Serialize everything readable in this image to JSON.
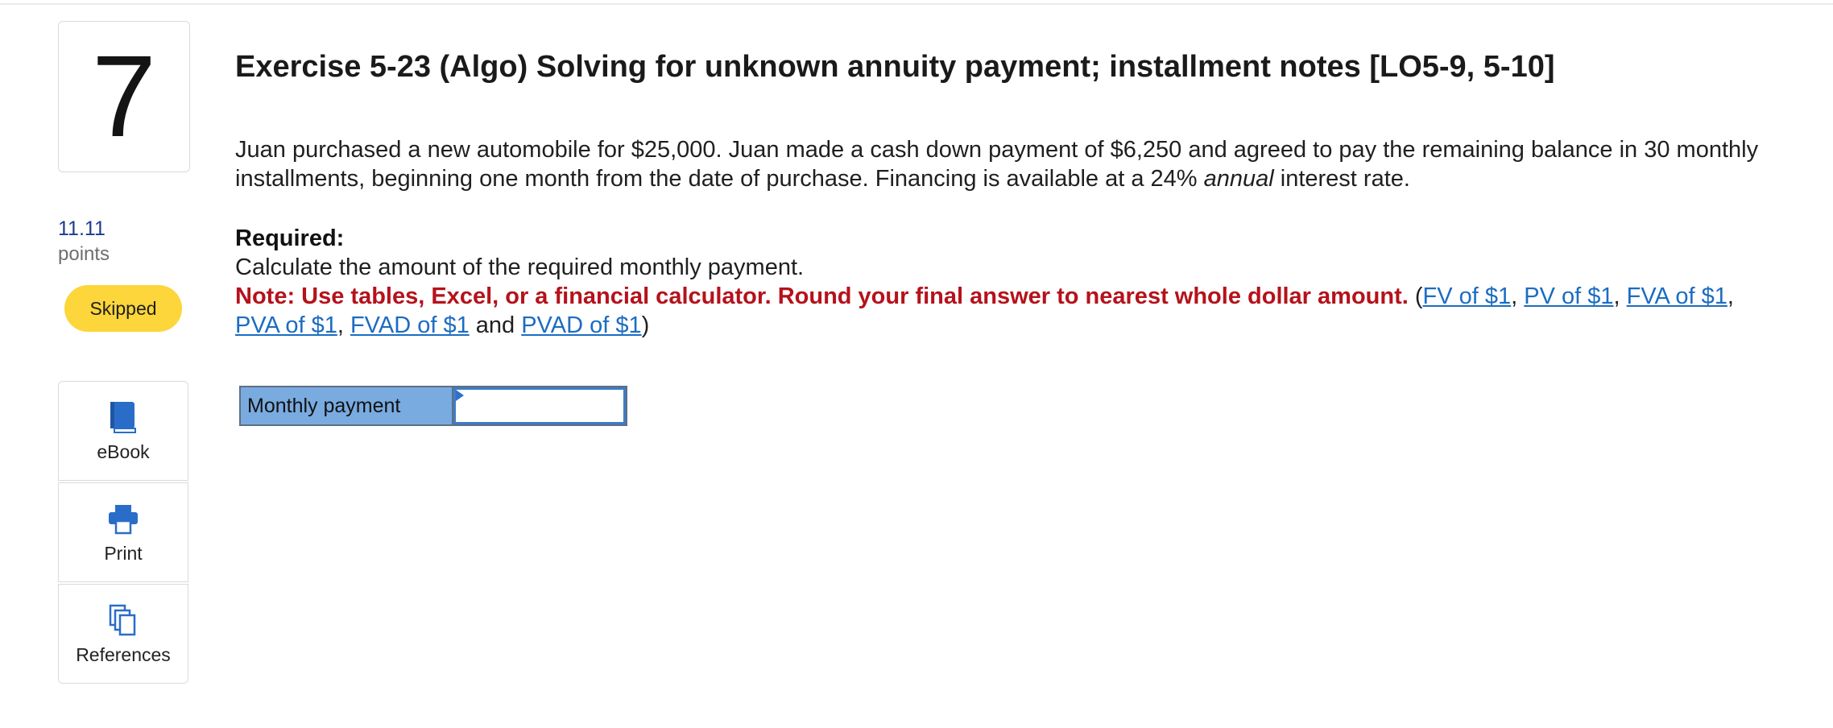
{
  "question": {
    "number": "7",
    "points_value": "11.11",
    "points_label": "points",
    "status": "Skipped"
  },
  "tools": [
    {
      "label": "eBook",
      "icon": "book-icon"
    },
    {
      "label": "Print",
      "icon": "printer-icon"
    },
    {
      "label": "References",
      "icon": "copy-documents-icon"
    }
  ],
  "exercise": {
    "title": "Exercise 5-23 (Algo) Solving for unknown annuity payment; installment notes [LO5-9, 5-10]",
    "body_before_italic": "Juan purchased a new automobile for $25,000. Juan made a cash down payment of $6,250 and agreed to pay the remaining balance in 30 monthly installments, beginning one month from the date of purchase. Financing is available at a 24% ",
    "body_italic": "annual",
    "body_after_italic": " interest rate.",
    "required_heading": "Required:",
    "required_text": "Calculate the amount of the required monthly payment.",
    "note_text": "Note: Use tables, Excel, or a financial calculator. Round your final answer to nearest whole dollar amount.",
    "links": [
      "FV of $1",
      "PV of $1",
      "FVA of $1",
      "PVA of $1",
      "FVAD of $1",
      "PVAD of $1"
    ],
    "paren_open": "(",
    "sep": ", ",
    "and_text": " and ",
    "paren_close": ")"
  },
  "answer": {
    "label": "Monthly payment",
    "value": ""
  },
  "colors": {
    "accent_blue": "#1b6cc2",
    "note_red": "#b5121b",
    "badge_yellow": "#fcd63a",
    "answer_label_bg": "#79abe0",
    "points_blue": "#1a3d8f"
  }
}
